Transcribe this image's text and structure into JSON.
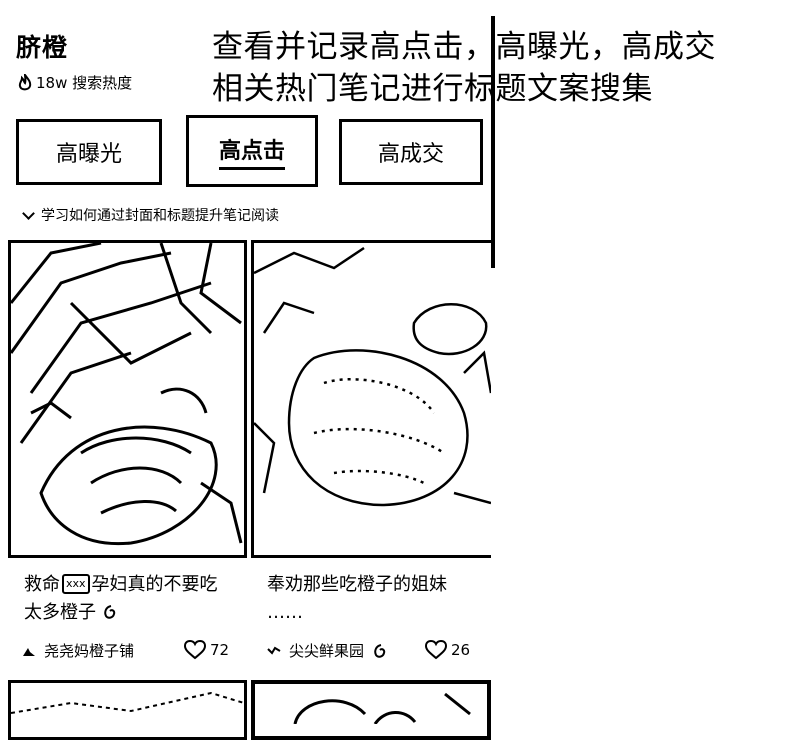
{
  "header": {
    "keyword": "脐橙",
    "heat": "18w 搜索热度"
  },
  "annotation": {
    "line1": "查看并记录高点击，高曝光，高成交",
    "line2": "相关热门笔记进行标题文案搜集"
  },
  "tabs": [
    {
      "label": "高曝光",
      "active": false
    },
    {
      "label": "高点击",
      "active": true
    },
    {
      "label": "高成交",
      "active": false
    }
  ],
  "tip": "学习如何通过封面和标题提升笔记阅读",
  "cards": [
    {
      "title_a": "救命",
      "title_emoji": "xxx",
      "title_b": "孕妇真的不要吃",
      "title_c": "太多橙子",
      "author": "尧尧妈橙子铺",
      "likes": "72"
    },
    {
      "title_a": "奉劝那些吃橙子的姐妹",
      "title_c": "……",
      "author": "尖尖鲜果园",
      "likes": "26"
    }
  ]
}
